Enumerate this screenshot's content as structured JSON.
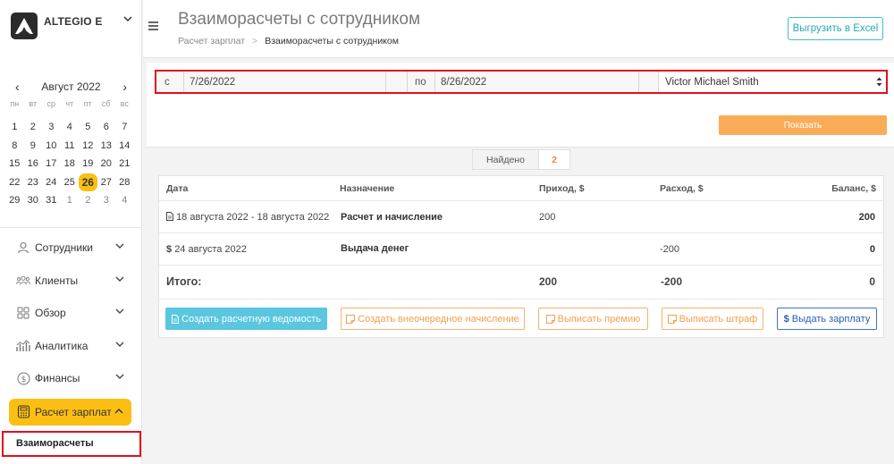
{
  "brand": {
    "name": "ALTEGIO E"
  },
  "calendar": {
    "month_label": "Август 2022",
    "prev": "‹",
    "next": "›",
    "weekdays": [
      "пн",
      "вт",
      "ср",
      "чт",
      "пт",
      "сб",
      "вс"
    ],
    "days": [
      {
        "d": "1"
      },
      {
        "d": "2"
      },
      {
        "d": "3"
      },
      {
        "d": "4"
      },
      {
        "d": "5"
      },
      {
        "d": "6"
      },
      {
        "d": "7"
      },
      {
        "d": "8"
      },
      {
        "d": "9"
      },
      {
        "d": "10"
      },
      {
        "d": "11"
      },
      {
        "d": "12"
      },
      {
        "d": "13"
      },
      {
        "d": "14"
      },
      {
        "d": "15"
      },
      {
        "d": "16"
      },
      {
        "d": "17"
      },
      {
        "d": "18"
      },
      {
        "d": "19"
      },
      {
        "d": "20"
      },
      {
        "d": "21"
      },
      {
        "d": "22"
      },
      {
        "d": "23"
      },
      {
        "d": "24"
      },
      {
        "d": "25"
      },
      {
        "d": "26",
        "selected": true
      },
      {
        "d": "27"
      },
      {
        "d": "28"
      },
      {
        "d": "29"
      },
      {
        "d": "30"
      },
      {
        "d": "31"
      },
      {
        "d": "1",
        "muted": true
      },
      {
        "d": "2",
        "muted": true
      },
      {
        "d": "3",
        "muted": true
      },
      {
        "d": "4",
        "muted": true
      }
    ]
  },
  "menu": {
    "items": [
      {
        "label": "Сотрудники",
        "icon": "user-icon"
      },
      {
        "label": "Клиенты",
        "icon": "clients-icon"
      },
      {
        "label": "Обзор",
        "icon": "grid-icon"
      },
      {
        "label": "Аналитика",
        "icon": "analytics-icon"
      },
      {
        "label": "Финансы",
        "icon": "dollar-circle-icon"
      }
    ],
    "active": {
      "label": "Расчет зарплат",
      "icon": "calculator-icon"
    },
    "sub_item": "Взаиморасчеты"
  },
  "header": {
    "title": "Взаиморасчеты с сотрудником",
    "breadcrumb": [
      "Расчет зарплат",
      "Взаиморасчеты с сотрудником"
    ],
    "breadcrumb_sep": ">",
    "export_label": "Выгрузить в Excel"
  },
  "filter": {
    "from_label": "с",
    "from_value": "7/26/2022",
    "to_label": "по",
    "to_value": "8/26/2022",
    "employee": "Victor Michael Smith",
    "show_label": "Показать"
  },
  "found": {
    "label": "Найдено",
    "count": "2"
  },
  "table": {
    "headers": [
      "Дата",
      "Назначение",
      "Приход, $",
      "Расход, $",
      "Баланс, $"
    ],
    "rows": [
      {
        "icon": "document-icon",
        "date": "18 августа 2022 - 18 августа 2022",
        "purpose": "Расчет и начисление",
        "income": "200",
        "expense": "",
        "balance": "200"
      },
      {
        "icon": "dollar-icon",
        "date": "24 августа 2022",
        "purpose": "Выдача денег",
        "income": "",
        "expense": "-200",
        "balance": "0"
      }
    ],
    "total": {
      "label": "Итого:",
      "income": "200",
      "expense": "-200",
      "balance": "0"
    }
  },
  "actions": {
    "create_statement": "Создать расчетную ведомость",
    "create_extra": "Создать внеочередное начисление",
    "bonus": "Выписать премию",
    "fine": "Выписать штраф",
    "pay": "Выдать зарплату"
  },
  "colors": {
    "accent_yellow": "#fbbf14",
    "orange": "#f8ac58",
    "teal": "#3ec0c6",
    "cyan": "#5ac6e0",
    "blue": "#3d73c9",
    "highlight_red": "#e0101a"
  }
}
